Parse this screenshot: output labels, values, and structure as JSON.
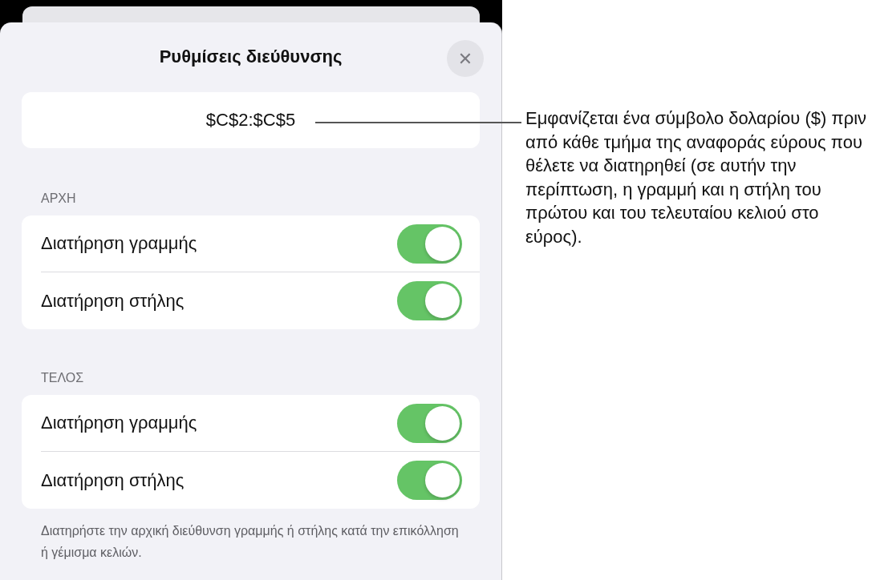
{
  "sheet": {
    "title": "Ρυθμίσεις διεύθυνσης",
    "close": "✕"
  },
  "address": {
    "value": "$C$2:$C$5"
  },
  "sections": [
    {
      "header": "ΑΡΧΗ",
      "rows": [
        {
          "label": "Διατήρηση γραμμής",
          "on": true
        },
        {
          "label": "Διατήρηση στήλης",
          "on": true
        }
      ]
    },
    {
      "header": "ΤΕΛΟΣ",
      "rows": [
        {
          "label": "Διατήρηση γραμμής",
          "on": true
        },
        {
          "label": "Διατήρηση στήλης",
          "on": true
        }
      ]
    }
  ],
  "footer": "Διατηρήστε την αρχική διεύθυνση γραμμής ή στήλης κατά την επικόλληση ή γέμισμα κελιών.",
  "callout": "Εμφανίζεται ένα σύμβολο δολαρίου ($) πριν από κάθε τμήμα της αναφοράς εύρους που θέλετε να διατηρηθεί (σε αυτήν την περίπτωση, η γραμμή και η στήλη του πρώτου και του τελευταίου κελιού στο εύρος)."
}
